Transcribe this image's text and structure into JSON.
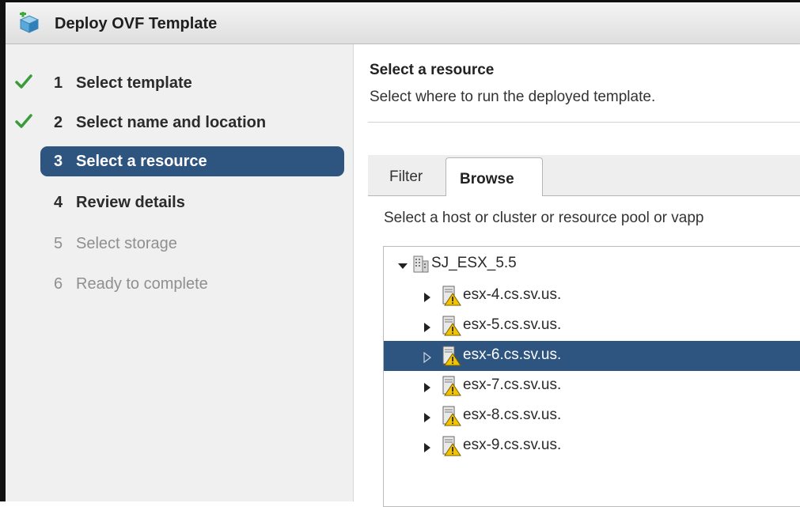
{
  "window": {
    "title": "Deploy OVF Template"
  },
  "steps": [
    {
      "num": "1",
      "label": "Select template",
      "state": "done"
    },
    {
      "num": "2",
      "label": "Select name and location",
      "state": "done"
    },
    {
      "num": "3",
      "label": "Select a resource",
      "state": "active"
    },
    {
      "num": "4",
      "label": "Review details",
      "state": "enabled"
    },
    {
      "num": "5",
      "label": "Select storage",
      "state": "disabled"
    },
    {
      "num": "6",
      "label": "Ready to complete",
      "state": "disabled"
    }
  ],
  "main": {
    "heading": "Select a resource",
    "subheading": "Select where to run the deployed template.",
    "tabs": [
      {
        "label": "Filter"
      },
      {
        "label": "Browse",
        "selected": true
      }
    ],
    "instructions": "Select a host or cluster or resource pool or vapp"
  },
  "tree": {
    "root": {
      "label": "SJ_ESX_5.5",
      "expanded": true,
      "icon": "datacenter-icon"
    },
    "hosts": [
      {
        "label": "esx-4.cs.sv.us.",
        "icon": "host-warning-icon"
      },
      {
        "label": "esx-5.cs.sv.us.",
        "icon": "host-warning-icon"
      },
      {
        "label": "esx-6.cs.sv.us.",
        "icon": "host-warning-icon",
        "selected": true
      },
      {
        "label": "esx-7.cs.sv.us.",
        "icon": "host-warning-icon"
      },
      {
        "label": "esx-8.cs.sv.us.",
        "icon": "host-warning-icon"
      },
      {
        "label": "esx-9.cs.sv.us.",
        "icon": "host-warning-icon"
      }
    ]
  },
  "colors": {
    "accent": "#2e5580",
    "check": "#3a9b3a",
    "warning": "#f2c400"
  }
}
